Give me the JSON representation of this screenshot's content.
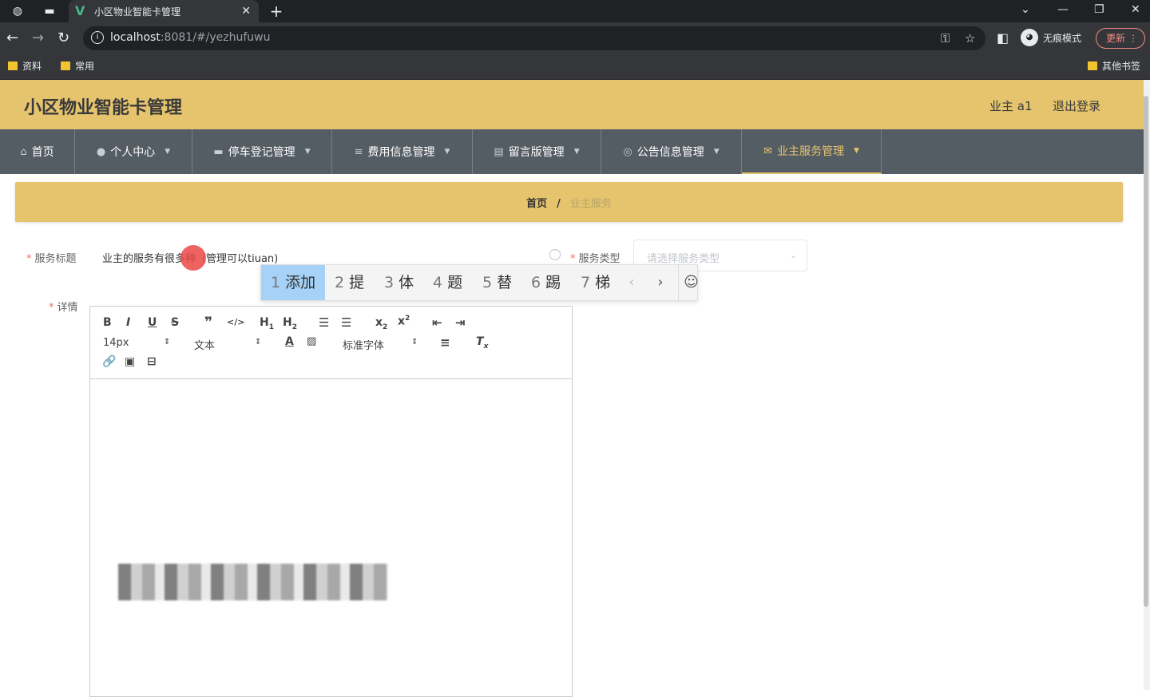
{
  "browser": {
    "tab_title": "小区物业智能卡管理",
    "url_host": "localhost",
    "url_rest": ":8081/#/yezhufuwu",
    "profile_label": "无痕模式",
    "update_label": "更新",
    "bookmarks": [
      "资料",
      "常用"
    ],
    "other_bookmarks": "其他书签"
  },
  "header": {
    "title": "小区物业智能卡管理",
    "user": "业主 a1",
    "logout": "退出登录"
  },
  "menu": [
    {
      "label": "首页",
      "icon": "home-icon",
      "has_arrow": false
    },
    {
      "label": "个人中心",
      "icon": "user-icon",
      "has_arrow": true
    },
    {
      "label": "停车登记管理",
      "icon": "briefcase-icon",
      "has_arrow": true
    },
    {
      "label": "费用信息管理",
      "icon": "list-icon",
      "has_arrow": true
    },
    {
      "label": "留言版管理",
      "icon": "document-icon",
      "has_arrow": true
    },
    {
      "label": "公告信息管理",
      "icon": "compass-icon",
      "has_arrow": true
    },
    {
      "label": "业主服务管理",
      "icon": "mail-icon",
      "has_arrow": true,
      "active": true
    }
  ],
  "breadcrumb": {
    "home": "首页",
    "separator": "/",
    "current": "业主服务"
  },
  "form": {
    "title_label": "服务标题",
    "title_value": "业主的服务有很多种（管理可以tiuan)",
    "type_label": "服务类型",
    "type_placeholder": "请选择服务类型",
    "detail_label": "详情"
  },
  "ime": {
    "candidates": [
      {
        "n": "1",
        "text": "添加"
      },
      {
        "n": "2",
        "text": "提"
      },
      {
        "n": "3",
        "text": "体"
      },
      {
        "n": "4",
        "text": "题"
      },
      {
        "n": "5",
        "text": "替"
      },
      {
        "n": "6",
        "text": "踢"
      },
      {
        "n": "7",
        "text": "梯"
      }
    ]
  },
  "editor": {
    "font_size": "14px",
    "text_type": "文本",
    "font_family": "标准字体"
  },
  "colors": {
    "accent": "#e6c46e",
    "menu_bg": "#545c64",
    "required": "#f56c6c"
  }
}
